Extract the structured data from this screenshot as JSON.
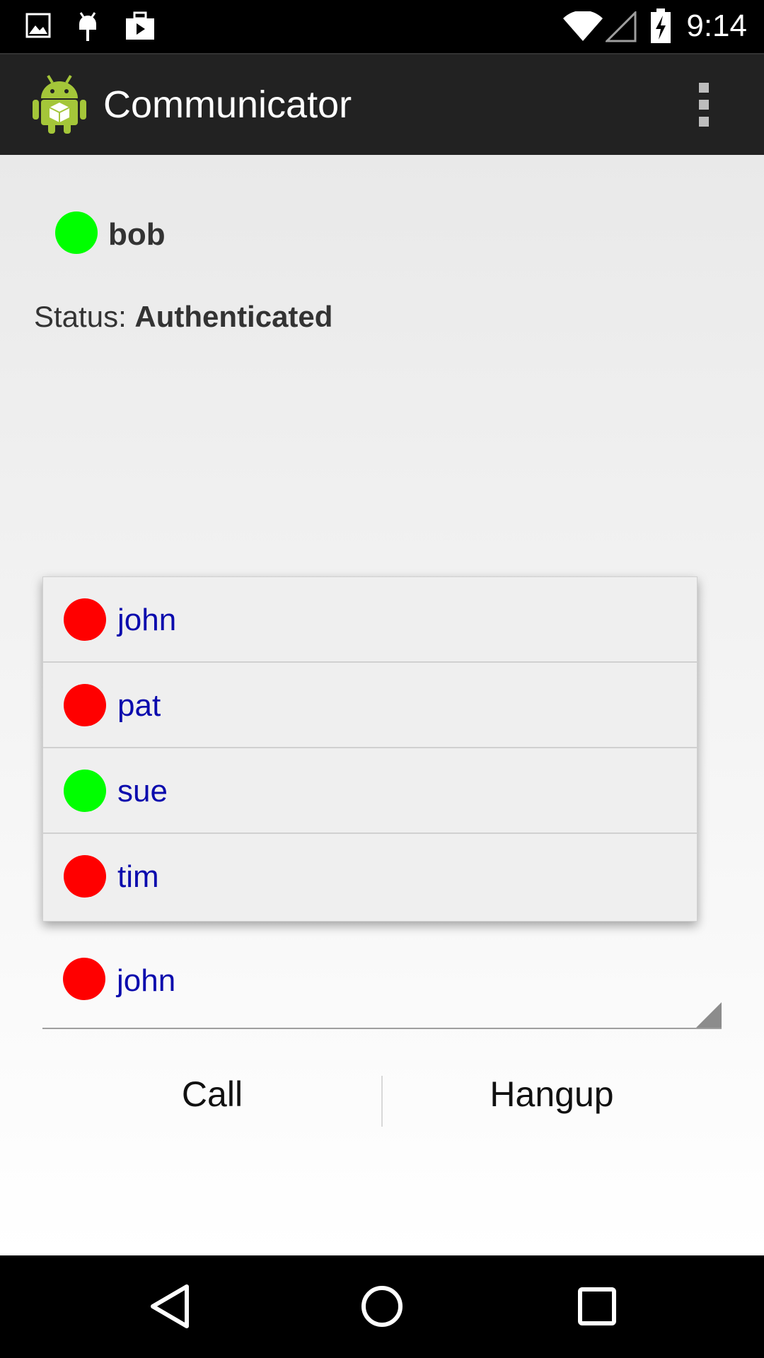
{
  "status_bar": {
    "time": "9:14",
    "icons": [
      "image-icon",
      "android-debug-icon",
      "briefcase-play-icon",
      "wifi-icon",
      "cell-signal-icon",
      "battery-charging-icon"
    ]
  },
  "action_bar": {
    "title": "Communicator",
    "logo_icon": "android-app-icon",
    "overflow_icon": "overflow-menu-icon"
  },
  "current_user": {
    "name": "bob",
    "presence_color": "#00ff00"
  },
  "status": {
    "label": "Status:",
    "value": "Authenticated"
  },
  "contacts_dropdown": {
    "items": [
      {
        "label": "john",
        "presence_color": "#ff0000"
      },
      {
        "label": "pat",
        "presence_color": "#ff0000"
      },
      {
        "label": "sue",
        "presence_color": "#00ff00"
      },
      {
        "label": "tim",
        "presence_color": "#ff0000"
      }
    ]
  },
  "spinner": {
    "selected_label": "john",
    "presence_color": "#ff0000"
  },
  "buttons": {
    "call_label": "Call",
    "hangup_label": "Hangup"
  },
  "colors": {
    "online": "#00ff00",
    "offline": "#ff0000",
    "contact_text": "#0b0bad",
    "action_bar": "#222222"
  },
  "nav_bar": {
    "icons": [
      "back-icon",
      "home-icon",
      "recents-icon"
    ]
  }
}
